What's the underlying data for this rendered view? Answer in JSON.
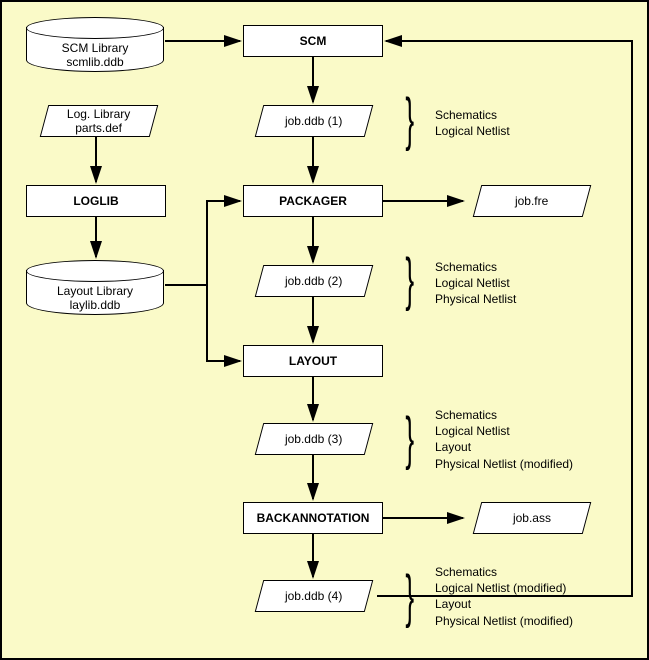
{
  "nodes": {
    "scm_library": "SCM Library\nscmlib.ddb",
    "scm": "SCM",
    "log_library": "Log. Library\nparts.def",
    "loglib": "LOGLIB",
    "layout_library": "Layout Library\nlaylib.ddb",
    "packager": "PACKAGER",
    "layout": "LAYOUT",
    "backannotation": "BACKANNOTATION",
    "job_ddb_1": "job.ddb (1)",
    "job_ddb_2": "job.ddb (2)",
    "job_ddb_3": "job.ddb (3)",
    "job_ddb_4": "job.ddb (4)",
    "job_fre": "job.fre",
    "job_ass": "job.ass"
  },
  "annotations": {
    "a1": "Schematics\nLogical Netlist",
    "a2": "Schematics\nLogical Netlist\nPhysical Netlist",
    "a3": "Schematics\nLogical Netlist\nLayout\nPhysical Netlist (modified)",
    "a4": "Schematics\nLogical Netlist (modified)\nLayout\nPhysical Netlist (modified)"
  }
}
